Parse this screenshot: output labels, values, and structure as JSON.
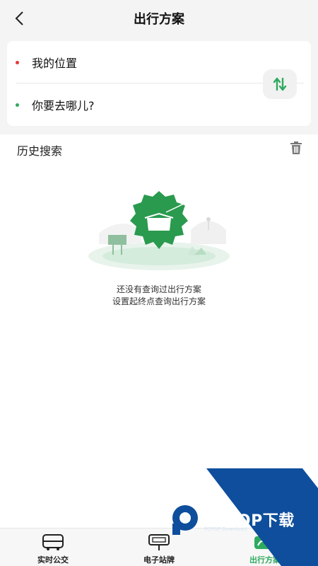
{
  "header": {
    "title": "出行方案"
  },
  "route": {
    "origin": "我的位置",
    "destination": "你要去哪儿?",
    "origin_color": "#e53935",
    "destination_color": "#2eaa5e"
  },
  "history": {
    "title": "历史搜索",
    "empty_line1": "还没有查询过出行方案",
    "empty_line2": "设置起终点查询出行方案"
  },
  "tabs": [
    {
      "label": "实时公交",
      "icon": "bus-icon",
      "active": false
    },
    {
      "label": "电子站牌",
      "icon": "station-sign-icon",
      "active": false
    },
    {
      "label": "出行方案",
      "icon": "route-plan-icon",
      "active": true
    }
  ],
  "colors": {
    "accent": "#2eaa5e",
    "watermark_blue": "#0e4e9c"
  },
  "watermark": {
    "text": "PCPOP下载",
    "sub": "PCPOP Download"
  }
}
